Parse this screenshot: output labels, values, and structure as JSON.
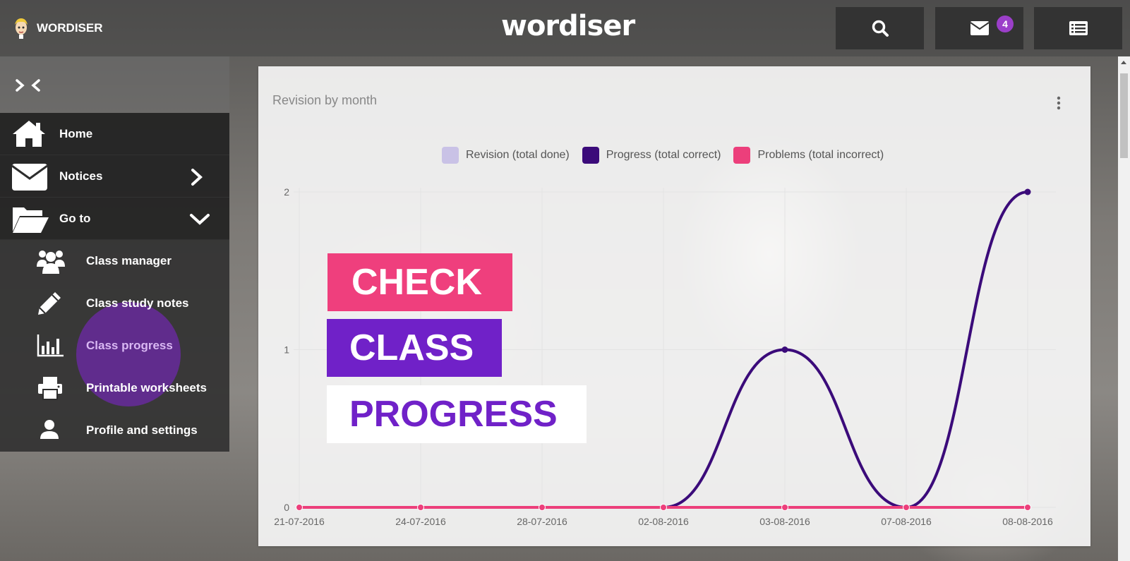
{
  "header": {
    "brand": "WORDISER",
    "logo": "wordiser",
    "notification_count": "4",
    "buttons": [
      "search-icon",
      "envelope-icon",
      "list-icon"
    ]
  },
  "sidebar": {
    "items": [
      {
        "label": "Home",
        "icon": "home-icon"
      },
      {
        "label": "Notices",
        "icon": "envelope-icon"
      },
      {
        "label": "Go to",
        "icon": "folder-open-icon"
      }
    ],
    "subitems": [
      {
        "label": "Class manager",
        "icon": "users-icon"
      },
      {
        "label": "Class study notes",
        "icon": "pencil-icon"
      },
      {
        "label": "Class progress",
        "icon": "bar-chart-icon"
      },
      {
        "label": "Printable worksheets",
        "icon": "printer-icon"
      },
      {
        "label": "Profile and settings",
        "icon": "user-icon"
      }
    ]
  },
  "overlay": {
    "line1": "CHECK",
    "line2": "CLASS",
    "line3": "PROGRESS",
    "colors": {
      "pink": "#ef3f7d",
      "purple": "#7021c8"
    }
  },
  "card": {
    "title": "Revision by month"
  },
  "chart_data": {
    "type": "line",
    "categories": [
      "21-07-2016",
      "24-07-2016",
      "28-07-2016",
      "02-08-2016",
      "03-08-2016",
      "07-08-2016",
      "08-08-2016"
    ],
    "series": [
      {
        "name": "Revision (total done)",
        "color": "#c9c2e6",
        "values": [
          0,
          0,
          0,
          0,
          1,
          0,
          2
        ]
      },
      {
        "name": "Progress (total correct)",
        "color": "#3b0b7a",
        "values": [
          0,
          0,
          0,
          0,
          1,
          0,
          2
        ]
      },
      {
        "name": "Problems (total incorrect)",
        "color": "#ec3f7b",
        "values": [
          0,
          0,
          0,
          0,
          0,
          0,
          0
        ]
      }
    ],
    "yticks": [
      "0",
      "1",
      "2"
    ],
    "ylim": [
      0,
      2
    ],
    "grid": true,
    "legend": "top-center"
  }
}
